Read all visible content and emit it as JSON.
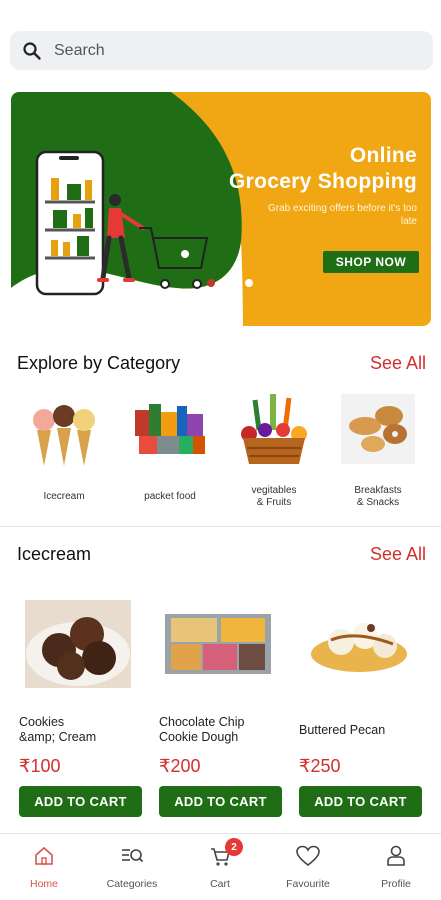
{
  "search": {
    "placeholder": "Search"
  },
  "banner": {
    "title_line1": "Online",
    "title_line2": "Grocery Shopping",
    "subtitle": "Grab exciting offers before it's too late",
    "button_label": "SHOP NOW",
    "dots": 3,
    "active_dot": 0
  },
  "categories_section": {
    "title": "Explore by Category",
    "see_all": "See All",
    "items": [
      {
        "label": "Icecream",
        "icon": "icecream-cones"
      },
      {
        "label": "packet food",
        "icon": "packet-food"
      },
      {
        "label": "vegitables\n& Fruits",
        "icon": "vegetable-basket"
      },
      {
        "label": "Breakfasts\n& Snacks",
        "icon": "breads"
      }
    ]
  },
  "product_section": {
    "title": "Icecream",
    "see_all": "See All",
    "items": [
      {
        "name": "Cookies\n&amp; Cream",
        "price": "₹100",
        "button": "ADD TO CART"
      },
      {
        "name": "Chocolate Chip\nCookie Dough",
        "price": "₹200",
        "button": "ADD TO CART"
      },
      {
        "name": "Buttered Pecan",
        "price": "₹250",
        "button": "ADD TO CART"
      }
    ]
  },
  "bottom_nav": {
    "items": [
      {
        "label": "Home",
        "icon": "home-icon",
        "active": true
      },
      {
        "label": "Categories",
        "icon": "categories-icon",
        "active": false
      },
      {
        "label": "Cart",
        "icon": "cart-icon",
        "active": false,
        "badge": "2"
      },
      {
        "label": "Favourite",
        "icon": "heart-icon",
        "active": false
      },
      {
        "label": "Profile",
        "icon": "profile-icon",
        "active": false
      }
    ]
  },
  "colors": {
    "brand_green": "#1f6e16",
    "banner_yellow": "#f0a713",
    "accent_red": "#d32f2f",
    "search_bg": "#eef0f4"
  }
}
